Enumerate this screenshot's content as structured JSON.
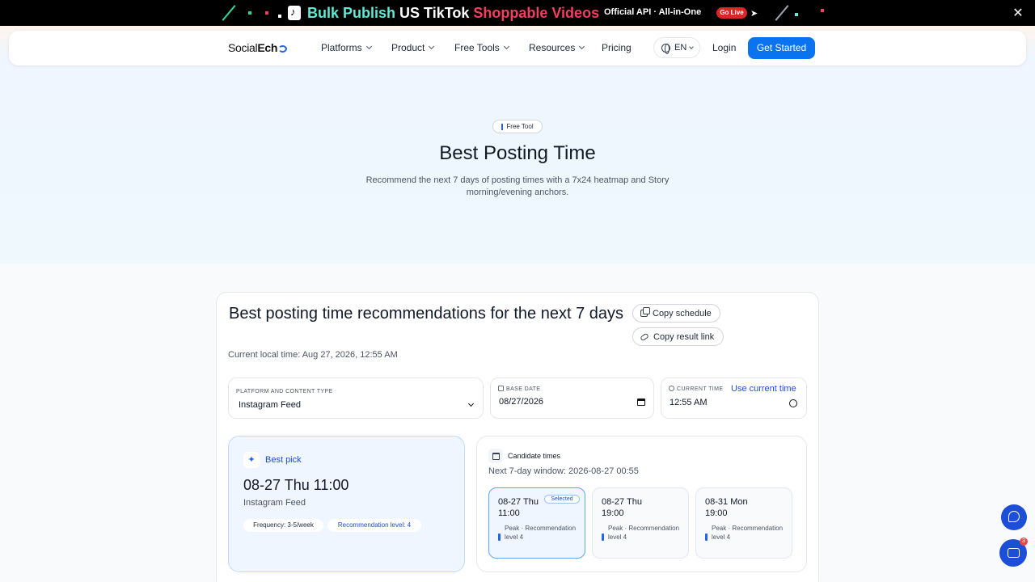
{
  "promo": {
    "text_part1": "Bulk Publish",
    "text_part2": "US TikTok",
    "text_part3": "Shoppable Videos",
    "api_text": "Official API · All-in-One",
    "live_badge": "Go Live",
    "close_glyph": "✕"
  },
  "nav": {
    "logo_prefix": "Social",
    "logo_bold": "Ech",
    "items": [
      {
        "label": "Platforms"
      },
      {
        "label": "Product"
      },
      {
        "label": "Free Tools"
      },
      {
        "label": "Resources"
      },
      {
        "label": "Pricing"
      }
    ],
    "language": "EN",
    "login": "Login",
    "cta": "Get Started"
  },
  "hero": {
    "badge": "Free Tool",
    "title": "Best Posting Time",
    "subtitle": "Recommend the next 7 days of posting times with a 7x24 heatmap and Story morning/evening anchors."
  },
  "card": {
    "title": "Best posting time recommendations for the next 7 days",
    "copy_schedule": "Copy schedule",
    "copy_link": "Copy result link",
    "local_time": "Current local time: Aug 27, 2026, 12:55 AM",
    "fields": {
      "platform_label": "Platform and content type",
      "platform_value": "Instagram Feed",
      "date_label": "Base date",
      "date_value": "08/27/2026",
      "time_label": "Current time",
      "time_value": "12:55 AM",
      "use_current": "Use current time"
    },
    "best": {
      "label": "Best pick",
      "time": "08-27 Thu 11:00",
      "type": "Instagram Feed",
      "frequency": "Frequency: 3-5/week",
      "level": "Recommendation level: 4"
    },
    "candidates": {
      "title": "Candidate times",
      "window": "Next 7-day window: 2026-08-27 00:55",
      "selected_label": "Selected",
      "slots": [
        {
          "time": "08-27 Thu 11:00",
          "desc": "Peak · Recommendation level 4",
          "selected": true
        },
        {
          "time": "08-27 Thu 19:00",
          "desc": "Peak · Recommendation level 4",
          "selected": false
        },
        {
          "time": "08-31 Mon 19:00",
          "desc": "Peak · Recommendation level 4",
          "selected": false
        }
      ]
    }
  },
  "chat": {
    "unread_count": "3"
  },
  "colors": {
    "accent": "#0a74f0",
    "promo_teal": "#5eead4",
    "promo_red": "#f43f5e"
  }
}
